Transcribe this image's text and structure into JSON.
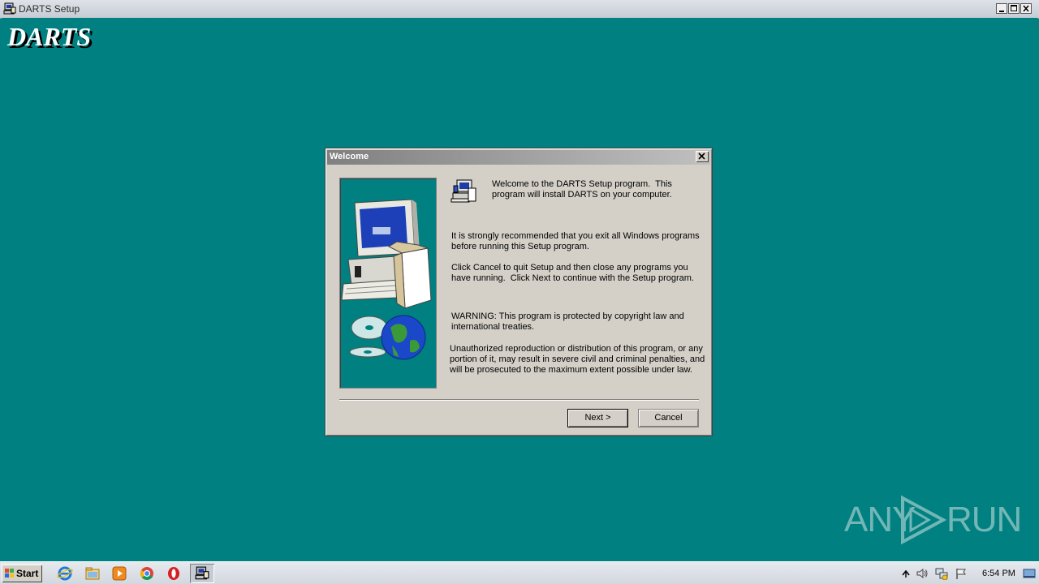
{
  "window": {
    "title": "DARTS Setup",
    "brand": "DARTS"
  },
  "dialog": {
    "title": "Welcome",
    "welcome_text": "Welcome to the DARTS Setup program.  This\nprogram will install DARTS on your computer.",
    "recommend_text": "It is strongly recommended that you exit all Windows programs\nbefore running this Setup program.",
    "cancel_text": "Click Cancel to quit Setup and then close any programs you\nhave running.  Click Next to continue with the Setup program.",
    "warning_text": "WARNING: This program is protected by copyright law and\ninternational treaties.",
    "unauthorized_text": "Unauthorized reproduction or distribution of this program, or any\nportion of it, may result in severe civil and criminal penalties, and\nwill be prosecuted to the maximum extent possible under law.",
    "next_label": "Next >",
    "cancel_label": "Cancel"
  },
  "watermark": {
    "text_left": "ANY",
    "text_right": "RUN"
  },
  "taskbar": {
    "start_label": "Start",
    "pinned": [
      "internet-explorer-icon",
      "file-explorer-icon",
      "media-player-icon",
      "chrome-icon",
      "opera-icon",
      "setup-app-icon"
    ],
    "tray": [
      "show-hidden-icons-icon",
      "volume-icon",
      "network-icon",
      "action-center-flag-icon"
    ],
    "clock": "6:54 PM"
  },
  "colors": {
    "desktop": "#008080",
    "dialog_face": "#d4d0c8",
    "titlebar_inactive_start": "#808080",
    "titlebar_inactive_end": "#c0c0c0"
  }
}
